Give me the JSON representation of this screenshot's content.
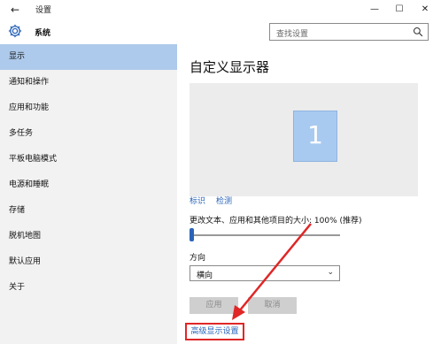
{
  "window": {
    "title": "设置",
    "back_glyph": "←",
    "minimize_glyph": "—",
    "maximize_glyph": "☐",
    "close_glyph": "✕"
  },
  "header": {
    "section": "系统",
    "search_placeholder": "查找设置"
  },
  "sidebar": {
    "items": [
      {
        "label": "显示",
        "active": true
      },
      {
        "label": "通知和操作",
        "active": false
      },
      {
        "label": "应用和功能",
        "active": false
      },
      {
        "label": "多任务",
        "active": false
      },
      {
        "label": "平板电脑模式",
        "active": false
      },
      {
        "label": "电源和睡眠",
        "active": false
      },
      {
        "label": "存储",
        "active": false
      },
      {
        "label": "脱机地图",
        "active": false
      },
      {
        "label": "默认应用",
        "active": false
      },
      {
        "label": "关于",
        "active": false
      }
    ]
  },
  "main": {
    "title": "自定义显示器",
    "monitor_number": "1",
    "identify_link": "标识",
    "detect_link": "检测",
    "scale_label": "更改文本、应用和其他项目的大小: 100% (推荐)",
    "scale_value_percent": 100,
    "scale_slider_fraction": 0.0,
    "orientation_label": "方向",
    "orientation_value": "横向",
    "apply_label": "应用",
    "cancel_label": "取消",
    "advanced_link": "高级显示设置"
  },
  "colors": {
    "accent": "#2a64b8",
    "sidebar_active": "#adc9eb",
    "monitor_fill": "#a9caf0",
    "highlight_red": "#e02626"
  }
}
